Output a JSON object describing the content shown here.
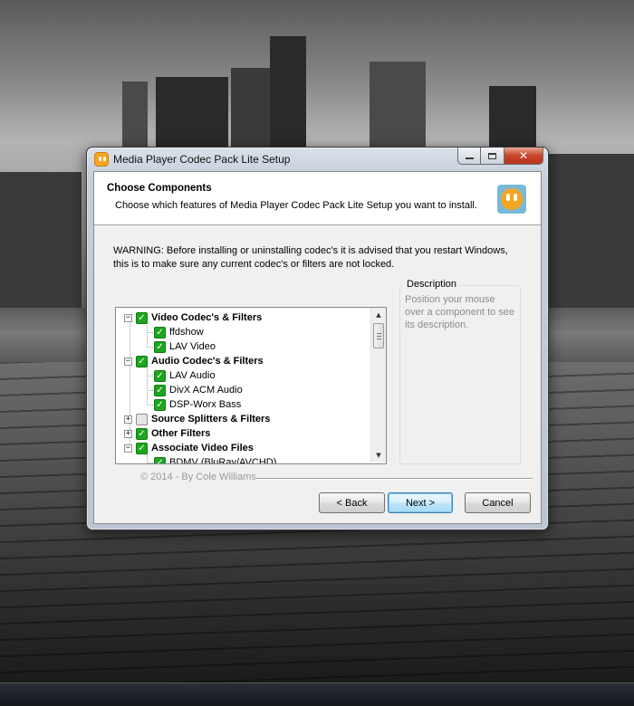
{
  "window": {
    "title": "Media Player Codec Pack Lite Setup"
  },
  "header": {
    "title": "Choose Components",
    "subtitle": "Choose which features of Media Player Codec Pack Lite Setup you want to install."
  },
  "warning_text": "WARNING: Before installing or uninstalling codec's it is advised that you restart Windows, this is to make sure any current codec's or filters are not locked.",
  "components": [
    {
      "label": "Video Codec's & Filters",
      "checked": true,
      "expanded": true,
      "level": 0
    },
    {
      "label": "ffdshow",
      "checked": true,
      "level": 1
    },
    {
      "label": "LAV Video",
      "checked": true,
      "level": 1
    },
    {
      "label": "Audio Codec's & Filters",
      "checked": true,
      "expanded": true,
      "level": 0
    },
    {
      "label": "LAV Audio",
      "checked": true,
      "level": 1
    },
    {
      "label": "DivX ACM Audio",
      "checked": true,
      "level": 1
    },
    {
      "label": "DSP-Worx Bass",
      "checked": true,
      "level": 1
    },
    {
      "label": "Source Splitters & Filters",
      "checked": false,
      "expanded": false,
      "level": 0
    },
    {
      "label": "Other Filters",
      "checked": true,
      "expanded": false,
      "level": 0
    },
    {
      "label": "Associate Video Files",
      "checked": true,
      "expanded": true,
      "level": 0
    },
    {
      "label": "BDMV (BluRay/AVCHD)",
      "checked": true,
      "level": 1
    }
  ],
  "description": {
    "label": "Description",
    "text": "Position your mouse over a component to see its description."
  },
  "footer": {
    "credit": "© 2014 - By Cole Williams"
  },
  "buttons": {
    "back": "< Back",
    "next": "Next >",
    "cancel": "Cancel"
  },
  "icons": {
    "app": "smiley-face-icon",
    "minimize": "minimize-icon",
    "maximize": "maximize-icon",
    "close": "close-icon"
  },
  "colors": {
    "checkbox_checked": "#1fa51f",
    "app_icon": "#f5a623",
    "logo_background": "#7ab9d6"
  }
}
